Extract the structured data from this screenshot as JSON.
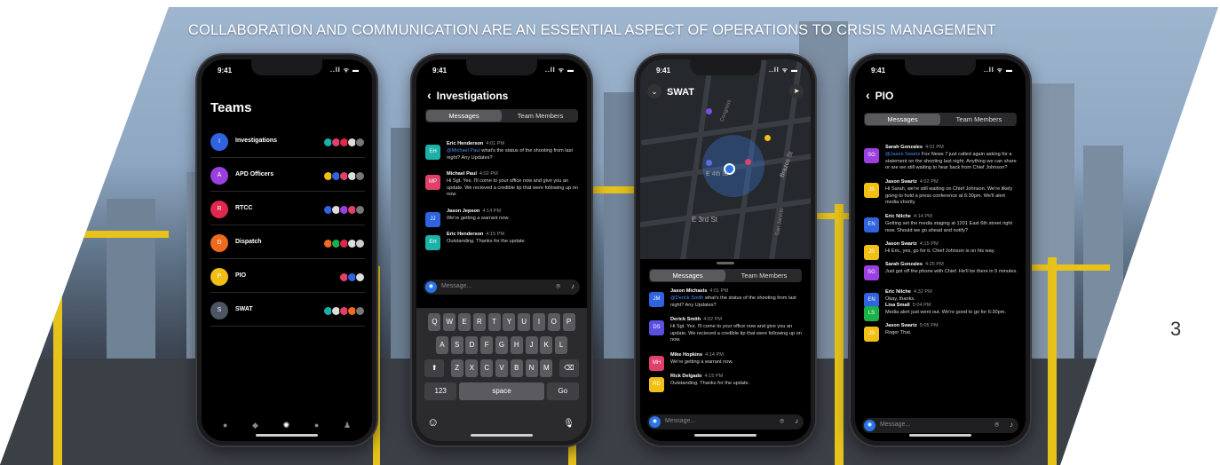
{
  "headline": "COLLABORATION AND COMMUNICATION ARE AN ESSENTIAL ASPECT OF OPERATIONS TO CRISIS MANAGEMENT",
  "page_number": "3",
  "status_time": "9:41",
  "status_right": "..ll ᯤ ▬",
  "colors": {
    "accent_blue": "#2a74e8",
    "crane_yellow": "#e6c21a"
  },
  "phone1": {
    "title": "Teams",
    "teams": [
      {
        "initial": "I",
        "name": "Investigations",
        "color": "#2f63e0"
      },
      {
        "initial": "A",
        "name": "APD Officers",
        "color": "#9b3fe0"
      },
      {
        "initial": "R",
        "name": "RTCC",
        "color": "#e0284f"
      },
      {
        "initial": "D",
        "name": "Dispatch",
        "color": "#ee6a1c"
      },
      {
        "initial": "P",
        "name": "PIO",
        "color": "#f2c014"
      },
      {
        "initial": "S",
        "name": "SWAT",
        "color": "#4b5563"
      }
    ],
    "tab_icons": [
      "map-pin-icon",
      "bell-icon",
      "people-icon",
      "chat-icon",
      "person-icon"
    ]
  },
  "phone2": {
    "back": "‹",
    "title": "Investigations",
    "seg_messages": "Messages",
    "seg_members": "Team Members",
    "messages": [
      {
        "initials": "EH",
        "color": "#1bb0a8",
        "name": "Eric Henderson",
        "time": "4:01 PM",
        "mention": "@Michael Paul",
        "text": " what's the status of the shooting from last night? Any Updates?"
      },
      {
        "initials": "MP",
        "color": "#e0406a",
        "name": "Michael Paul",
        "time": "4:02 PM",
        "mention": "",
        "text": "Hi Sgt. Yes. I'll come to your office now and give you an update. We recieved a credible tip that were following up on now."
      },
      {
        "initials": "JJ",
        "color": "#2f63e0",
        "name": "Jason Jepson",
        "time": "4:14 PM",
        "mention": "",
        "text": "We're getting a warrant now."
      },
      {
        "initials": "EH",
        "color": "#1bb0a8",
        "name": "Eric Henderson",
        "time": "4:15 PM",
        "mention": "",
        "text": "Outstanding. Thanks for the update."
      }
    ],
    "input_placeholder": "Message...",
    "keyboard": {
      "row1": [
        "Q",
        "W",
        "E",
        "R",
        "T",
        "Y",
        "U",
        "I",
        "O",
        "P"
      ],
      "row2": [
        "A",
        "S",
        "D",
        "F",
        "G",
        "H",
        "J",
        "K",
        "L"
      ],
      "row3": [
        "Z",
        "X",
        "C",
        "V",
        "B",
        "N",
        "M"
      ],
      "shift": "⬆",
      "delete": "⌫",
      "num": "123",
      "space": "space",
      "go": "Go",
      "emoji": "☺",
      "mic": "🎙"
    }
  },
  "phone3": {
    "title": "SWAT",
    "map_labels": [
      "E 4th St",
      "Brazos St",
      "E 3rd St",
      "Congress",
      "San Jacinto"
    ],
    "seg_messages": "Messages",
    "seg_members": "Team Members",
    "messages": [
      {
        "initials": "JM",
        "color": "#2f63e0",
        "name": "Jason Michaels",
        "time": "4:01 PM",
        "mention": "@Derick Smith",
        "text": " what's the status of the shooting from last night? Any Updates?"
      },
      {
        "initials": "DS",
        "color": "#5b4fe0",
        "name": "Derick Smith",
        "time": "4:02 PM",
        "mention": "",
        "text": "Hi Sgt. Yes. I'll come to your office now and give you an update. We recieved a credible tip that were following up on now."
      },
      {
        "initials": "MH",
        "color": "#e0406a",
        "name": "Mike Hopkins",
        "time": "4:14 PM",
        "mention": "",
        "text": "We're getting a warrant now."
      },
      {
        "initials": "RD",
        "color": "#f2c014",
        "name": "Rick Delgado",
        "time": "4:15 PM",
        "mention": "",
        "text": "Outstanding. Thanks for the update."
      }
    ],
    "input_placeholder": "Message..."
  },
  "phone4": {
    "back": "‹",
    "title": "PIO",
    "seg_messages": "Messages",
    "seg_members": "Team Members",
    "messages": [
      {
        "initials": "SG",
        "color": "#9b3fe0",
        "name": "Sarah Gonzales",
        "time": "4:01 PM",
        "mention": "@Jason Swartz",
        "text": " Fox News 7 just called again asking for a statement on the shooting last night. Anything we can share or are we still waiting to hear back from Chief Johnson?"
      },
      {
        "initials": "JS",
        "color": "#f2c014",
        "name": "Jason Swartz",
        "time": "4:02 PM",
        "mention": "",
        "text": "Hi Sarah, we're still waiting on Chief Johnson. We're likely going to hold a press conference at 6:30pm. We'll alert media shortly."
      },
      {
        "initials": "EN",
        "color": "#2f63e0",
        "name": "Eric Nilche",
        "time": "4:14 PM",
        "mention": "",
        "text": "Getting set the media staging at 1201 East 6th street right now. Should we go ahead and notify?"
      },
      {
        "initials": "JS",
        "color": "#f2c014",
        "name": "Jason Swartz",
        "time": "4:15 PM",
        "mention": "",
        "text": "Hi Eric, yes, go for it. Chief Johnson is on his way."
      },
      {
        "initials": "SG",
        "color": "#9b3fe0",
        "name": "Sarah Gonzales",
        "time": "4:25 PM",
        "mention": "",
        "text": "Just got off the phone with Chief. He'll be there in 5 minutes."
      },
      {
        "initials": "EN",
        "color": "#2f63e0",
        "name": "Eric Nilche",
        "time": "4:32 PM",
        "mention": "",
        "text": "Okay, thanks."
      },
      {
        "initials": "LS",
        "color": "#1bb04a",
        "name": "Lisa Small",
        "time": "5:04 PM",
        "mention": "",
        "text": "Media alert just went out. We're good to go for 6:30pm."
      },
      {
        "initials": "JS",
        "color": "#f2c014",
        "name": "Jason Swartz",
        "time": "5:05 PM",
        "mention": "",
        "text": "Roger That."
      }
    ],
    "input_placeholder": "Message..."
  }
}
